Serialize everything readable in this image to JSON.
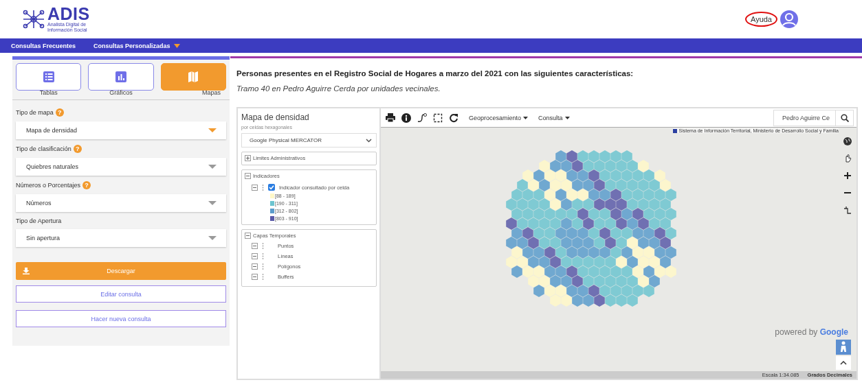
{
  "header": {
    "logo_title": "ADIS",
    "logo_subtitle": "Analista Digital de Información Social",
    "help_link": "Ayuda"
  },
  "nav": [
    {
      "label": "Consultas Frecuentes",
      "has_menu": false
    },
    {
      "label": "Consultas Personalizadas",
      "has_menu": true
    }
  ],
  "view_tabs": [
    {
      "label": "Tablas",
      "kind": "table",
      "selected": false
    },
    {
      "label": "Gráficos",
      "kind": "chart",
      "selected": false
    },
    {
      "label": "Mapas",
      "kind": "map",
      "selected": true
    }
  ],
  "form_fields": [
    {
      "label": "Tipo de mapa",
      "help": "?",
      "value": "Mapa de densidad",
      "focused": true
    },
    {
      "label": "Tipo de clasificación",
      "help": "?",
      "value": "Quiebres naturales",
      "focused": false
    },
    {
      "label": "Números o Porcentajes",
      "help": "?",
      "value": "Números",
      "focused": false
    },
    {
      "label": "Tipo de Apertura",
      "value": "Sin apertura",
      "focused": false
    }
  ],
  "actions": [
    {
      "label": "Descargar",
      "kind": "primary"
    },
    {
      "label": "Editar consulta",
      "kind": "outline"
    },
    {
      "label": "Hacer nueva consulta",
      "kind": "outline"
    }
  ],
  "content": {
    "title": "Personas presentes en el Registro Social de Hogares a marzo del 2021 con las siguientes características:",
    "subtitle": "Tramo 40 en Pedro Aguirre Cerda por unidades vecinales."
  },
  "map_panel": {
    "title": "Mapa de densidad",
    "subtitle": "por celdas hexagonales",
    "basemap": "Google Physical MERCATOR",
    "groups": [
      {
        "label": "Limites Administrativos",
        "expanded": false
      },
      {
        "label": "Indicadores",
        "expanded": true,
        "children": [
          {
            "label": "Indicador consultado por celda",
            "kind": "checkbox",
            "checked": true,
            "legend": [
              {
                "label": "[88 - 189]",
                "color": "#fff8c8"
              },
              {
                "label": "[190 - 311]",
                "color": "#6cc4cf"
              },
              {
                "label": "[312 - 802]",
                "color": "#5b9ccb"
              },
              {
                "label": "[803 - 910]",
                "color": "#5a5aa8"
              }
            ]
          }
        ]
      },
      {
        "label": "Capas Temporales",
        "expanded": true,
        "children": [
          {
            "label": "Puntos",
            "kind": "layer"
          },
          {
            "label": "Líneas",
            "kind": "layer"
          },
          {
            "label": "Polígonos",
            "kind": "layer"
          },
          {
            "label": "Buffers",
            "kind": "layer"
          }
        ]
      }
    ]
  },
  "map_toolbar": {
    "menus": [
      "Geoprocesamiento",
      "Consulta"
    ],
    "search_value": "Pedro Aguirre Ce"
  },
  "map": {
    "attribution": "Sistema de Información Territorial, Ministerio de Desarrollo Social y Familia",
    "powered_by": "powered by",
    "brand": "Google",
    "scale": "Escala 1:34.085",
    "units": "Grados Decimales"
  }
}
